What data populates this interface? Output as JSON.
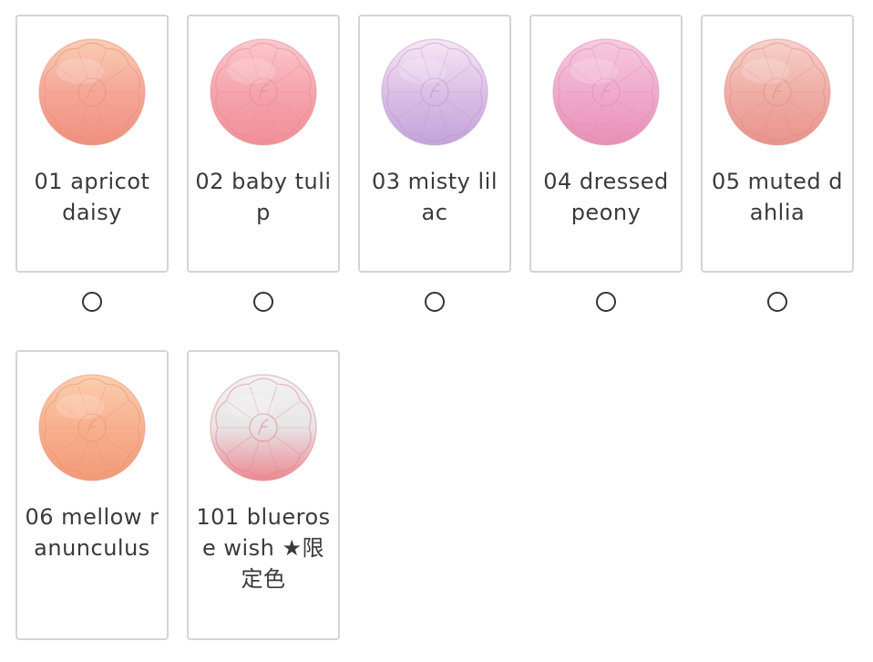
{
  "shades": [
    {
      "label": "01 apricot daisy",
      "icon": "apricot-blush-compact-icon",
      "colors": {
        "top": "#f9cdb4",
        "mid": "#f6a797",
        "bottom": "#f0907f",
        "emboss": "#e58f7d"
      },
      "selected": false
    },
    {
      "label": "02 baby tulip",
      "icon": "pink-blush-compact-icon",
      "colors": {
        "top": "#fbc9cc",
        "mid": "#f6a4ad",
        "bottom": "#f08f98",
        "emboss": "#e28b93"
      },
      "selected": false
    },
    {
      "label": "03 misty lilac",
      "icon": "lilac-blush-compact-icon",
      "colors": {
        "top": "#f8e6f4",
        "mid": "#dcc0e6",
        "bottom": "#c4a3d9",
        "emboss": "#b79ccc"
      },
      "selected": false
    },
    {
      "label": "04 dressed peony",
      "icon": "peony-blush-compact-icon",
      "colors": {
        "top": "#f6cbe0",
        "mid": "#f0aacd",
        "bottom": "#e890b6",
        "emboss": "#d98fb2"
      },
      "selected": false
    },
    {
      "label": "05 muted dahlia",
      "icon": "dahlia-blush-compact-icon",
      "colors": {
        "top": "#f6d2cb",
        "mid": "#f0aea7",
        "bottom": "#e8938c",
        "emboss": "#d98f88"
      },
      "selected": false
    },
    {
      "label": "06 mellow ranunculus",
      "icon": "ranunculus-blush-compact-icon",
      "colors": {
        "top": "#fbcfb0",
        "mid": "#f8b08e",
        "bottom": "#f29a78",
        "emboss": "#e59377"
      },
      "selected": false
    },
    {
      "label": "101 bluerose wish ★限定色",
      "icon": "bluerose-blush-compact-icon",
      "colors": {
        "top": "#f3f3f3",
        "mid": "#e8e4e6",
        "bottom": "#ec8891",
        "emboss": "#d9848c"
      },
      "selected": false
    }
  ],
  "border_color": "#d4d4d4"
}
